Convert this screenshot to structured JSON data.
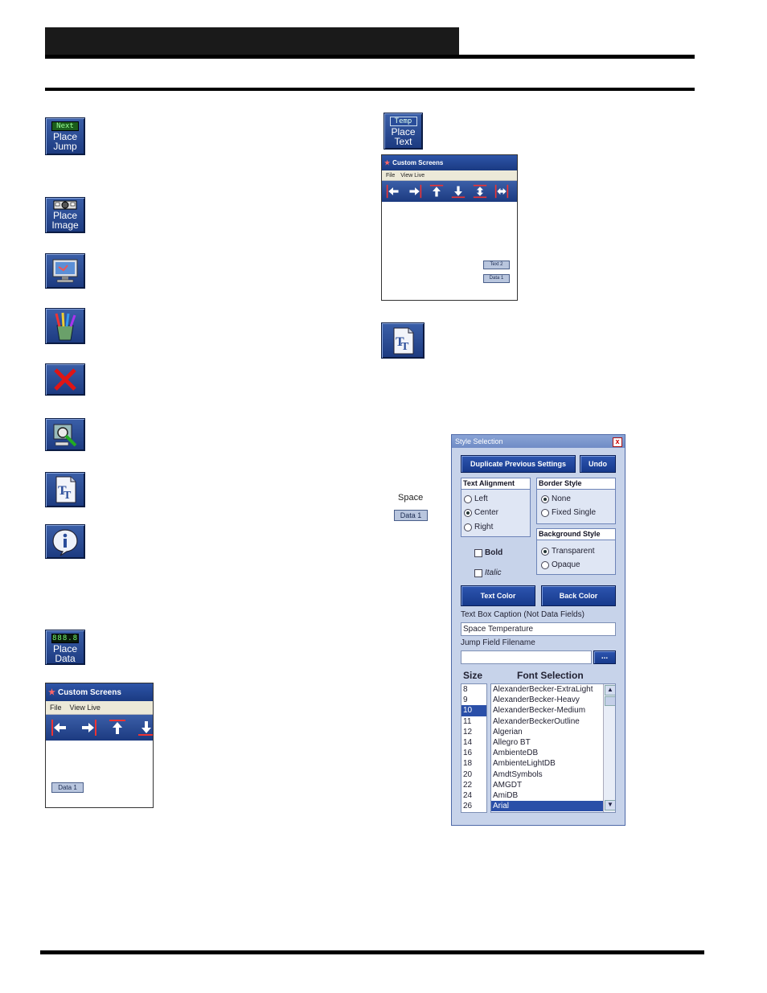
{
  "icons": {
    "place_jump": {
      "tag": "Next",
      "line1": "Place",
      "line2": "Jump"
    },
    "place_image": {
      "line1": "Place",
      "line2": "Image"
    },
    "place_data": {
      "tag": "888.8",
      "line1": "Place",
      "line2": "Data"
    },
    "place_text": {
      "tag": "Temp",
      "line1": "Place",
      "line2": "Text"
    }
  },
  "win_small": {
    "title": "Custom Screens",
    "menu": [
      "File",
      "View Live"
    ],
    "label_text": "Text 2",
    "label_data": "Data 1"
  },
  "win_large": {
    "title": "Custom Screens",
    "menu": [
      "File",
      "View Live"
    ],
    "label_data": "Data 1"
  },
  "preview": {
    "caption": "Space",
    "data": "Data 1"
  },
  "style_dialog": {
    "title": "Style Selection",
    "close": "x",
    "dup_btn": "Duplicate Previous Settings",
    "undo_btn": "Undo",
    "text_align": {
      "header": "Text Alignment",
      "options": [
        "Left",
        "Center",
        "Right"
      ],
      "selected": "Center"
    },
    "border": {
      "header": "Border Style",
      "options": [
        "None",
        "Fixed Single"
      ],
      "selected": "None"
    },
    "background": {
      "header": "Background Style",
      "options": [
        "Transparent",
        "Opaque"
      ],
      "selected": "Transparent"
    },
    "bold": "Bold",
    "italic": "Italic",
    "text_color_btn": "Text Color",
    "back_color_btn": "Back Color",
    "caption_label": "Text Box Caption (Not Data Fields)",
    "caption_value": "Space Temperature",
    "jump_label": "Jump Field Filename",
    "jump_value": "",
    "browse_btn": "...",
    "size_header": "Size",
    "font_header": "Font Selection",
    "sizes": [
      "8",
      "9",
      "10",
      "11",
      "12",
      "14",
      "16",
      "18",
      "20",
      "22",
      "24",
      "26"
    ],
    "selected_size": "10",
    "fonts": [
      "AlexanderBecker-ExtraLight",
      "AlexanderBecker-Heavy",
      "AlexanderBecker-Medium",
      "AlexanderBeckerOutline",
      "Algerian",
      "Allegro BT",
      "AmbienteDB",
      "AmbienteLightDB",
      "AmdtSymbols",
      "AMGDT",
      "AmiDB",
      "Arial"
    ],
    "selected_font": "Arial"
  }
}
